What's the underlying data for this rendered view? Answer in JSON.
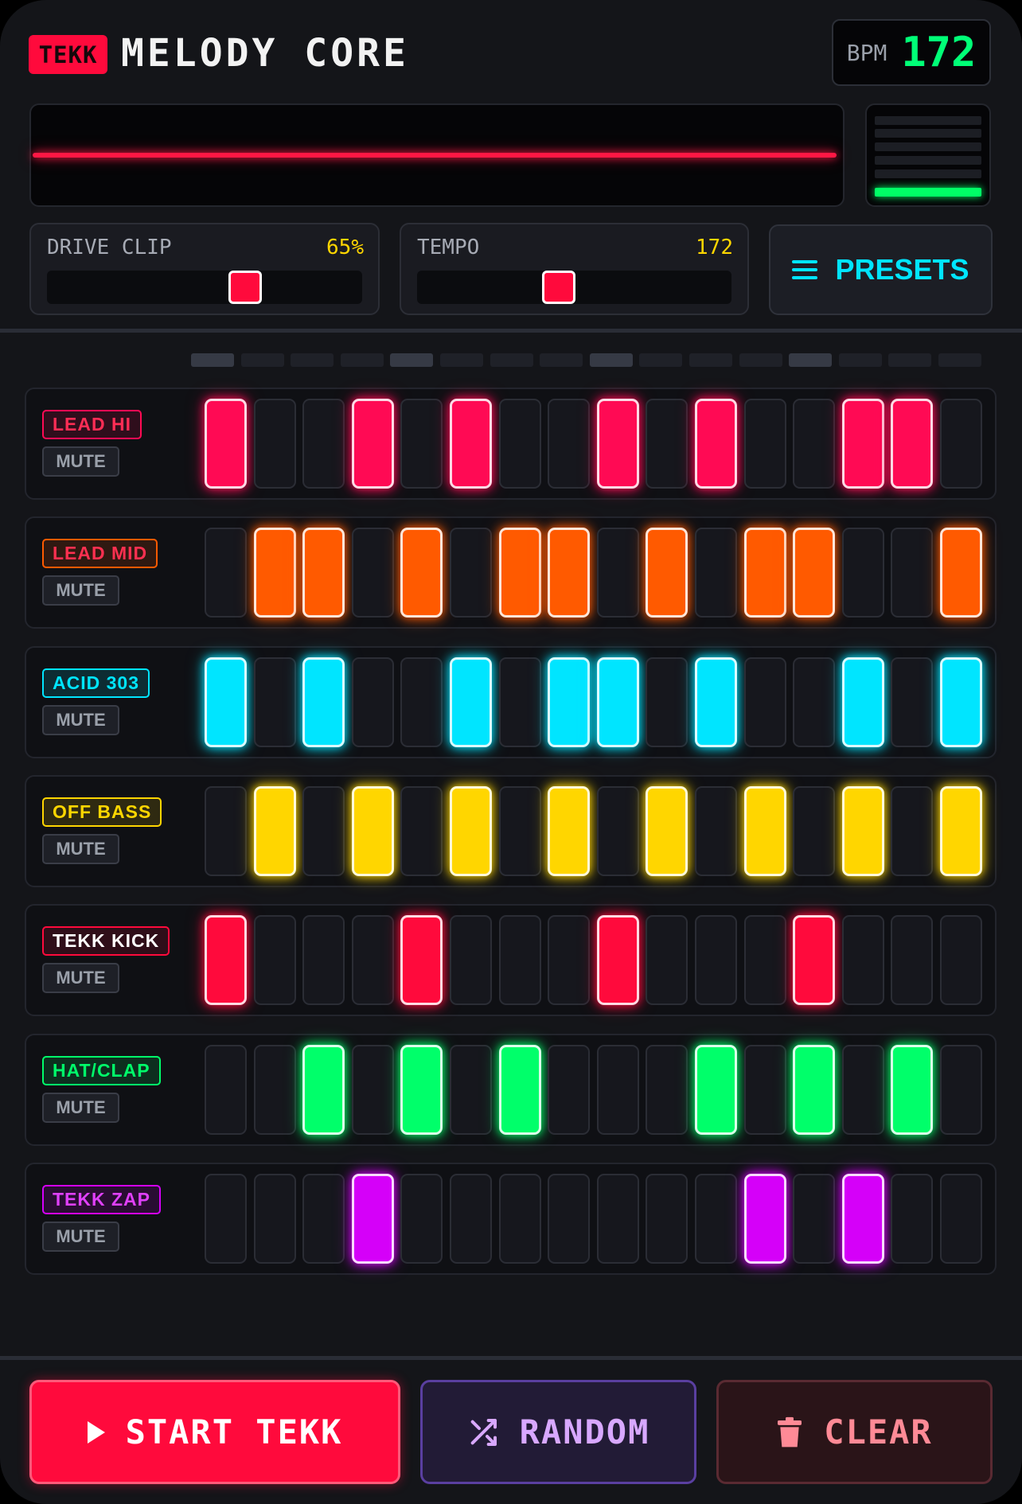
{
  "header": {
    "brand": "TEKK",
    "title": "MELODY CORE",
    "bpm_label": "BPM",
    "bpm_value": "172"
  },
  "level_meter": {
    "bars_total": 6,
    "bars_lit": 1,
    "lit_color": "#00ff66"
  },
  "controls": {
    "drive": {
      "label": "DRIVE CLIP",
      "value": "65%",
      "level": 0.63
    },
    "tempo": {
      "label": "TEMPO",
      "value": "172",
      "level": 0.45
    },
    "presets_label": "PRESETS"
  },
  "sequencer": {
    "steps": 16,
    "mute_label": "MUTE",
    "tracks": [
      {
        "name": "LEAD HI",
        "color": "#ff0a54",
        "text_color": "#ff2d55",
        "pattern": [
          1,
          0,
          0,
          1,
          0,
          1,
          0,
          0,
          1,
          0,
          1,
          0,
          0,
          1,
          1,
          0
        ]
      },
      {
        "name": "LEAD MID",
        "color": "#ff5a00",
        "text_color": "#ff3050",
        "pattern": [
          0,
          1,
          1,
          0,
          1,
          0,
          1,
          1,
          0,
          1,
          0,
          1,
          1,
          0,
          0,
          1
        ]
      },
      {
        "name": "ACID 303",
        "color": "#00e5ff",
        "text_color": "#00e5ff",
        "pattern": [
          1,
          0,
          1,
          0,
          0,
          1,
          0,
          1,
          1,
          0,
          1,
          0,
          0,
          1,
          0,
          1
        ]
      },
      {
        "name": "OFF BASS",
        "color": "#ffd600",
        "text_color": "#ffd600",
        "pattern": [
          0,
          1,
          0,
          1,
          0,
          1,
          0,
          1,
          0,
          1,
          0,
          1,
          0,
          1,
          0,
          1
        ]
      },
      {
        "name": "TEKK KICK",
        "color": "#ff0a3c",
        "text_color": "#ffffff",
        "pattern": [
          1,
          0,
          0,
          0,
          1,
          0,
          0,
          0,
          1,
          0,
          0,
          0,
          1,
          0,
          0,
          0
        ]
      },
      {
        "name": "HAT/CLAP",
        "color": "#00ff6a",
        "text_color": "#00ff6a",
        "pattern": [
          0,
          0,
          1,
          0,
          1,
          0,
          1,
          0,
          0,
          0,
          1,
          0,
          1,
          0,
          1,
          0
        ]
      },
      {
        "name": "TEKK ZAP",
        "color": "#d500f9",
        "text_color": "#e040fb",
        "pattern": [
          0,
          0,
          0,
          1,
          0,
          0,
          0,
          0,
          0,
          0,
          0,
          1,
          0,
          1,
          0,
          0
        ]
      }
    ]
  },
  "buttons": {
    "start": "START TEKK",
    "random": "RANDOM",
    "clear": "CLEAR"
  }
}
